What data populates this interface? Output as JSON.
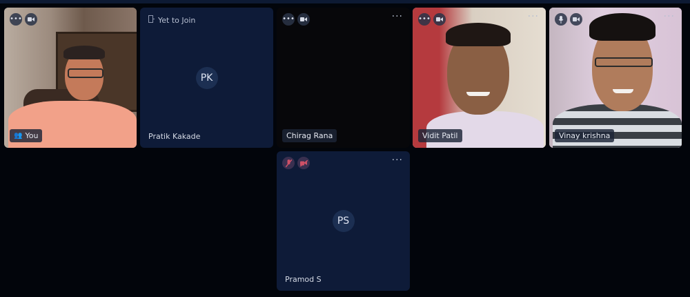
{
  "participants": [
    {
      "name": "You",
      "initials": "",
      "status": ""
    },
    {
      "name": "Pratik Kakade",
      "initials": "PK",
      "status": "Yet to Join"
    },
    {
      "name": "Chirag Rana",
      "initials": "",
      "status": ""
    },
    {
      "name": "Vidit Patil",
      "initials": "",
      "status": ""
    },
    {
      "name": "Vinay krishna",
      "initials": "",
      "status": ""
    },
    {
      "name": "Pramod S",
      "initials": "PS",
      "status": ""
    }
  ],
  "icons": {
    "options": "more-dots-icon",
    "camera": "camera-icon",
    "mic": "microphone-icon",
    "mic_muted": "microphone-muted-icon",
    "camera_off": "camera-off-icon",
    "user": "user-icon",
    "join": "door-icon"
  },
  "colors": {
    "background": "#02050b",
    "tile_blank": "#0e1b38",
    "avatar": "#1c2f52"
  }
}
